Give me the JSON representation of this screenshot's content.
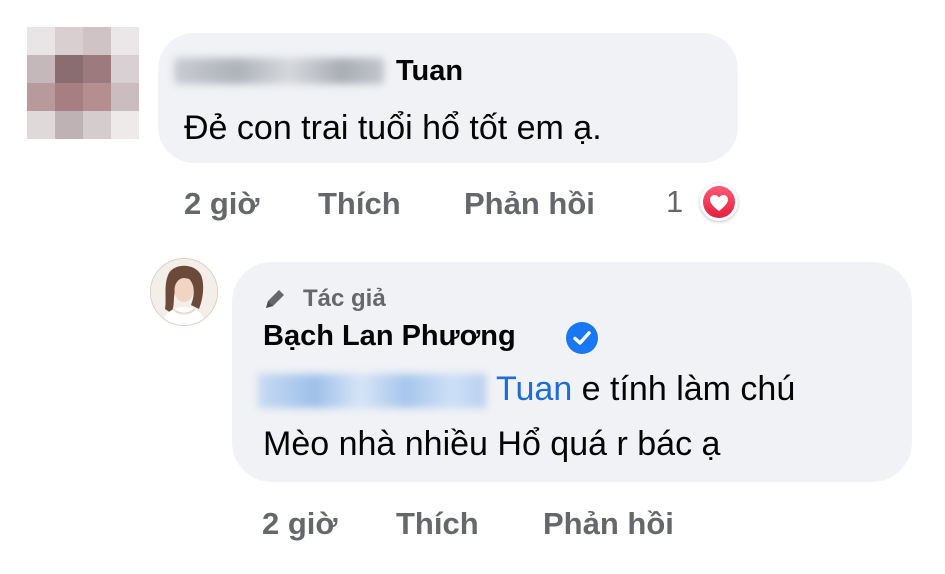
{
  "comment": {
    "author_name_suffix": "Tuan",
    "text": "Đẻ con trai tuổi hổ tốt em ạ.",
    "time": "2 giờ",
    "like_label": "Thích",
    "reply_label": "Phản hồi",
    "reaction_count": "1",
    "reaction_icon": "heart-icon"
  },
  "reply": {
    "author_badge": "Tác giả",
    "author_name": "Bạch Lan Phương",
    "mention_suffix": "Tuan",
    "text_line1": " e tính làm chú",
    "text_line2": "Mèo nhà nhiều Hổ quá r bác ạ",
    "time": "2 giờ",
    "like_label": "Thích",
    "reply_label": "Phản hồi"
  },
  "colors": {
    "bubble": "#f0f2f5",
    "action_text": "#65676b",
    "mention": "#1a6ed8",
    "verified": "#1877f2",
    "reaction": "#e41e3f"
  }
}
